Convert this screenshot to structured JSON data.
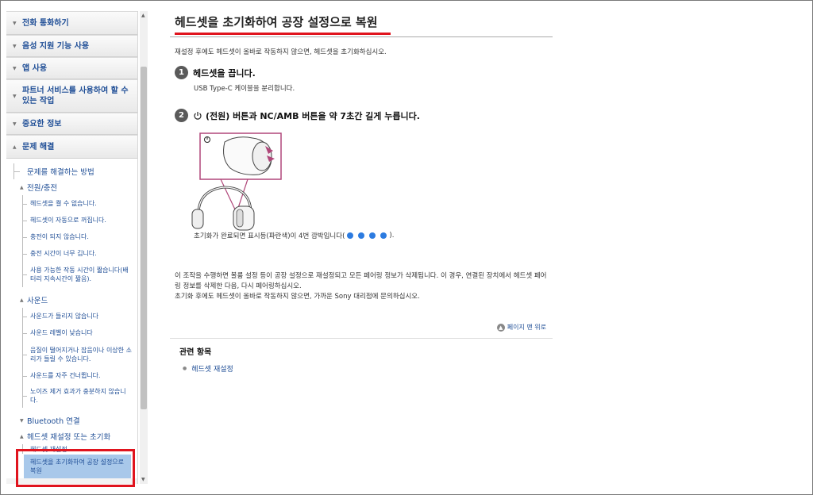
{
  "sidebar": {
    "categories": [
      {
        "label": "전화 통화하기"
      },
      {
        "label": "음성 지원 기능 사용"
      },
      {
        "label": "앱 사용"
      },
      {
        "label": "파트너 서비스를 사용하여 할 수 있는 작업"
      },
      {
        "label": "중요한 정보"
      },
      {
        "label": "문제 해결"
      }
    ],
    "troubleshoot_link": "문제를 해결하는 방법",
    "groups": {
      "power": "전원/충전",
      "sound": "사운드",
      "bluetooth": "Bluetooth 연결",
      "reset": "헤드셋 재설정 또는 초기화"
    },
    "power_items": [
      "헤드셋을 켤 수 없습니다.",
      "헤드셋이 자동으로 꺼집니다.",
      "충전이 되지 않습니다.",
      "충전 시간이 너무 깁니다.",
      "사용 가능한 작동 시간이 짧습니다(배터리 지속시간이 짧음)."
    ],
    "sound_items": [
      "사운드가 들리지 않습니다",
      "사운드 레벨이 낮습니다",
      "음질이 떨어지거나 잡음이나 이상한 소리가 들릴 수 있습니다.",
      "사운드를 자주 건너뜁니다.",
      "노이즈 제거 효과가 충분하지 않습니다."
    ],
    "reset_items": [
      "헤드셋 재설정",
      "헤드셋을 초기화하여 공장 설정으로 복원"
    ]
  },
  "main": {
    "title": "헤드셋을 초기화하여 공장 설정으로 복원",
    "intro": "재설정 후에도 헤드셋이 올바로 작동하지 않으면, 헤드셋을 초기화하십시오.",
    "step1": {
      "num": "1",
      "title": "헤드셋을 끕니다.",
      "desc": "USB Type-C 케이블을 분리합니다."
    },
    "step2": {
      "num": "2",
      "title": "(전원) 버튼과 NC/AMB 버튼을 약 7초간 길게 누릅니다."
    },
    "init_note_pre": "초기화가 완료되면 표시등(파란색)이 4번 깜박입니다(",
    "init_note_post": ").",
    "notes": [
      "이 조작을 수행하면 볼륨 설정 등이 공장 설정으로 재설정되고 모든 페어링 정보가 삭제됩니다. 이 경우, 연결된 장치에서 헤드셋 페어링 정보를 삭제한 다음, 다시 페어링하십시오.",
      "초기화 후에도 헤드셋이 올바로 작동하지 않으면, 가까운 Sony 대리점에 문의하십시오."
    ],
    "to_top": "페이지 맨 위로",
    "related_title": "관련 항목",
    "related_link": "헤드셋 재설정"
  },
  "colors": {
    "accent_red": "#e0141e",
    "link_blue": "#1f4e96",
    "indicator_blue": "#2c7be0"
  }
}
